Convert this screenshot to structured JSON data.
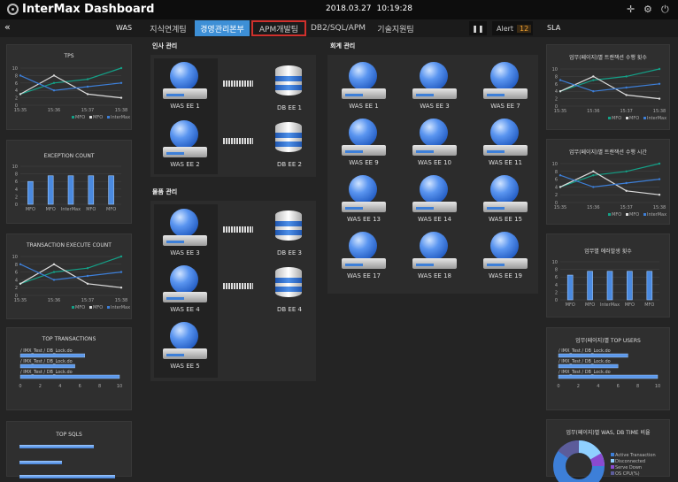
{
  "header": {
    "title": "InterMax Dashboard",
    "date": "2018.03.27",
    "time": "10:19:28"
  },
  "nav": {
    "left_toggle": "«",
    "left_title": "WAS",
    "right_title": "SLA",
    "tabs": [
      "지식연계팀",
      "경영관리본부",
      "APM개발팀",
      "DB2/SQL/APM",
      "기술지원팀"
    ],
    "pause": "❚❚",
    "alert_label": "Alert",
    "alert_count": "12"
  },
  "icons": [
    "crosshair-icon",
    "gear-icon",
    "power-icon",
    "pause-icon",
    "double-left-chevron-icon"
  ],
  "colors": {
    "series_mfo1": "#14a087",
    "series_mfo2": "#dddddd",
    "series_intermax": "#3d7fd8",
    "active_tab": "#3d8fd6",
    "outline": "#d0302c",
    "alert": "#f0a030"
  },
  "left": {
    "tps": {
      "title": "TPS",
      "y": [
        "10",
        "8",
        "6",
        "4",
        "2",
        "0"
      ],
      "x": [
        "15:35",
        "15:36",
        "15:37",
        "15:38"
      ],
      "legend": [
        "MFO",
        "MFO",
        "InterMax"
      ]
    },
    "exception": {
      "title": "EXCEPTION COUNT",
      "y": [
        "10",
        "8",
        "6",
        "4",
        "2",
        "0"
      ],
      "x": [
        "MFO",
        "MFO",
        "InterMax",
        "MFO",
        "MFO"
      ],
      "values": [
        6,
        7.5,
        7.5,
        7.5,
        7.5
      ]
    },
    "txn": {
      "title": "TRANSACTION EXECUTE COUNT",
      "y": [
        "10",
        "8",
        "6",
        "4",
        "2",
        "0"
      ],
      "x": [
        "15:35",
        "15:36",
        "15:37",
        "15:38"
      ],
      "legend": [
        "MFO",
        "MFO",
        "InterMax"
      ]
    },
    "top_txn": {
      "title": "TOP TRANSACTIONS",
      "labels": [
        "/ IMX_Test / DB_Lock.do",
        "/ IMX_Test / DB_Lock.do",
        "/ IMX_Test / DB_Lock.do"
      ],
      "values": [
        6.5,
        5.5,
        10
      ],
      "x": [
        "0",
        "2",
        "4",
        "6",
        "8",
        "10"
      ]
    },
    "top_sql": {
      "title": "TOP SQLS",
      "values": [
        7,
        4,
        9
      ]
    }
  },
  "center": {
    "hr": {
      "title": "인사 관리",
      "was": [
        "WAS EE 1",
        "WAS EE 2"
      ],
      "db": [
        "DB EE 1",
        "DB EE 2"
      ]
    },
    "logistics": {
      "title": "물품 관리",
      "was": [
        "WAS EE 3",
        "WAS EE 4",
        "WAS EE 5"
      ],
      "db": [
        "DB EE 3",
        "DB EE 4"
      ]
    },
    "accounting": {
      "title": "회계 관리",
      "was": [
        "WAS EE 1",
        "WAS EE 3",
        "WAS EE 7",
        "WAS EE 9",
        "WAS EE 10",
        "WAS EE 11",
        "WAS EE 13",
        "WAS EE 14",
        "WAS EE 15",
        "WAS EE 17",
        "WAS EE 18",
        "WAS EE 19"
      ]
    }
  },
  "right": {
    "sla_count": {
      "title": "업무(페이지)별 트랜잭션 수행 횟수",
      "y": [
        "10",
        "8",
        "6",
        "4",
        "2",
        "0"
      ],
      "x": [
        "15:35",
        "15:36",
        "15:37",
        "15:38"
      ],
      "legend": [
        "MFO",
        "MFO",
        "InterMax"
      ]
    },
    "sla_time": {
      "title": "업무(페이지)별 트랜잭션 수행 시간",
      "y": [
        "10",
        "8",
        "6",
        "4",
        "2",
        "0"
      ],
      "x": [
        "15:35",
        "15:36",
        "15:37",
        "15:38"
      ],
      "legend": [
        "MFO",
        "MFO",
        "InterMax"
      ]
    },
    "errors": {
      "title": "업무별 에러발생 횟수",
      "y": [
        "10",
        "8",
        "6",
        "4",
        "2",
        "0"
      ],
      "x": [
        "MFO",
        "MFO",
        "InterMax",
        "MFO",
        "MFO"
      ],
      "values": [
        6.5,
        7.5,
        7.5,
        7.5,
        7.5
      ]
    },
    "top_users": {
      "title": "업무(페이지)별 TOP USERS",
      "labels": [
        "/ IMX_Test / DB_Lock.do",
        "/ IMX_Test / DB_Lock.do",
        "/ IMX_Test / DB_Lock.do"
      ],
      "values": [
        7,
        6,
        10
      ]
    },
    "ratio": {
      "title": "업무(페이지)별 WAS, DB TIME 비율",
      "legend": [
        "Active Transaction",
        "Disconnected",
        "Serve Down",
        "OS CPU(%)"
      ],
      "legend_colors": [
        "#3d7fd8",
        "#8fd0ff",
        "#8a4ad0",
        "#5c5c9a"
      ]
    }
  },
  "chart_data": [
    {
      "type": "line",
      "title": "TPS",
      "x": [
        "15:35",
        "15:36",
        "15:37",
        "15:38"
      ],
      "ylim": [
        0,
        10
      ],
      "series": [
        {
          "name": "MFO",
          "values": [
            3,
            6,
            7,
            10
          ]
        },
        {
          "name": "MFO",
          "values": [
            3,
            8,
            3,
            2
          ]
        },
        {
          "name": "InterMax",
          "values": [
            8,
            4,
            5,
            6
          ]
        }
      ]
    },
    {
      "type": "bar",
      "title": "EXCEPTION COUNT",
      "categories": [
        "MFO",
        "MFO",
        "InterMax",
        "MFO",
        "MFO"
      ],
      "values": [
        6,
        7.5,
        7.5,
        7.5,
        7.5
      ],
      "ylim": [
        0,
        10
      ]
    },
    {
      "type": "line",
      "title": "TRANSACTION EXECUTE COUNT",
      "x": [
        "15:35",
        "15:36",
        "15:37",
        "15:38"
      ],
      "ylim": [
        0,
        10
      ],
      "series": [
        {
          "name": "MFO",
          "values": [
            3,
            6,
            7,
            10
          ]
        },
        {
          "name": "MFO",
          "values": [
            3,
            8,
            3,
            2
          ]
        },
        {
          "name": "InterMax",
          "values": [
            8,
            4,
            5,
            6
          ]
        }
      ]
    },
    {
      "type": "bar",
      "title": "TOP TRANSACTIONS",
      "categories": [
        "/ IMX_Test / DB_Lock.do",
        "/ IMX_Test / DB_Lock.do",
        "/ IMX_Test / DB_Lock.do"
      ],
      "values": [
        6.5,
        5.5,
        10
      ],
      "xlim": [
        0,
        10
      ]
    },
    {
      "type": "line",
      "title": "업무(페이지)별 트랜잭션 수행 횟수",
      "x": [
        "15:35",
        "15:36",
        "15:37",
        "15:38"
      ],
      "ylim": [
        0,
        10
      ],
      "series": [
        {
          "name": "MFO",
          "values": [
            4,
            7,
            8,
            10
          ]
        },
        {
          "name": "MFO",
          "values": [
            4,
            8,
            3,
            2
          ]
        },
        {
          "name": "InterMax",
          "values": [
            7,
            4,
            5,
            6
          ]
        }
      ]
    },
    {
      "type": "line",
      "title": "업무(페이지)별 트랜잭션 수행 시간",
      "x": [
        "15:35",
        "15:36",
        "15:37",
        "15:38"
      ],
      "ylim": [
        0,
        10
      ],
      "series": [
        {
          "name": "MFO",
          "values": [
            4,
            7,
            8,
            10
          ]
        },
        {
          "name": "MFO",
          "values": [
            4,
            8,
            3,
            2
          ]
        },
        {
          "name": "InterMax",
          "values": [
            7,
            4,
            5,
            6
          ]
        }
      ]
    },
    {
      "type": "bar",
      "title": "업무별 에러발생 횟수",
      "categories": [
        "MFO",
        "MFO",
        "InterMax",
        "MFO",
        "MFO"
      ],
      "values": [
        6.5,
        7.5,
        7.5,
        7.5,
        7.5
      ],
      "ylim": [
        0,
        10
      ]
    },
    {
      "type": "bar",
      "title": "업무(페이지)별 TOP USERS",
      "categories": [
        "/ IMX_Test / DB_Lock.do",
        "/ IMX_Test / DB_Lock.do",
        "/ IMX_Test / DB_Lock.do"
      ],
      "values": [
        7,
        6,
        10
      ],
      "xlim": [
        0,
        10
      ]
    }
  ]
}
